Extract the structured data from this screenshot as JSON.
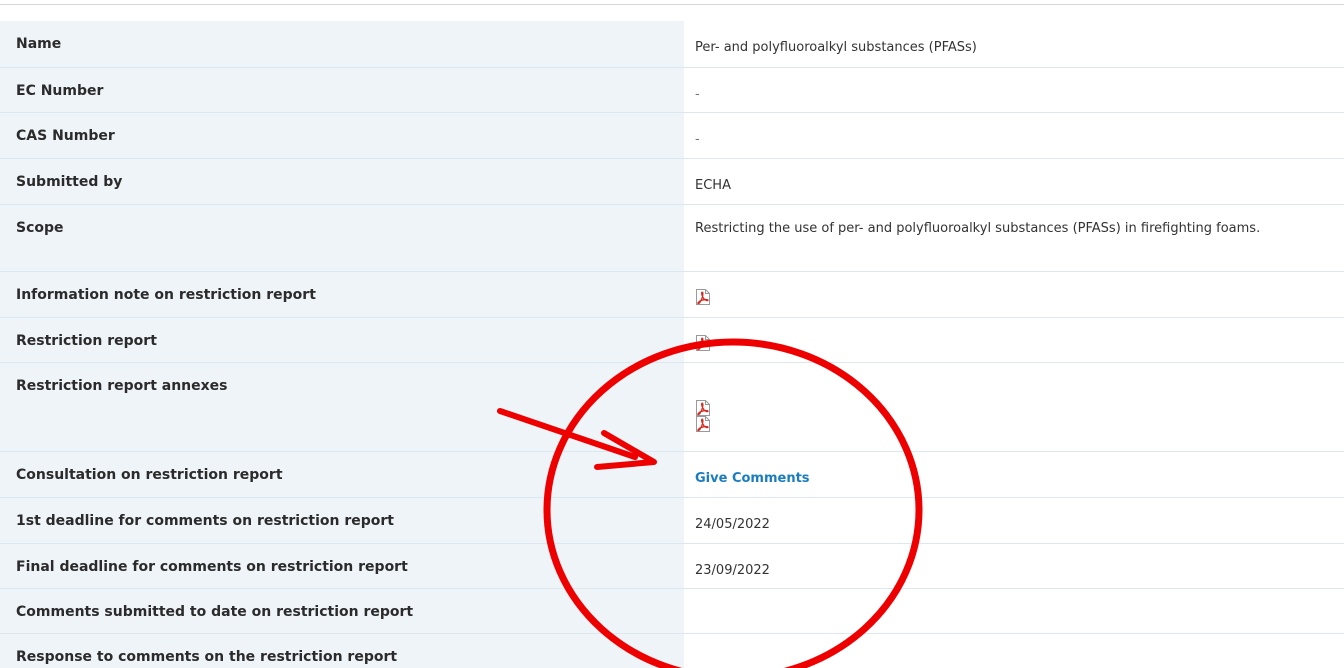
{
  "rows": [
    {
      "label": "Name",
      "value": "Per- and polyfluoroalkyl substances (PFASs)"
    },
    {
      "label": "EC Number",
      "value": "-"
    },
    {
      "label": "CAS Number",
      "value": "-"
    },
    {
      "label": "Submitted by",
      "value": "ECHA"
    },
    {
      "label": "Scope",
      "value": "Restricting the use of per- and polyfluoroalkyl substances (PFASs) in firefighting foams."
    },
    {
      "label": "Information note on restriction report",
      "icon": "pdf-icon"
    },
    {
      "label": "Restriction report",
      "icon": "pdf-icon"
    },
    {
      "label": "Restriction report annexes",
      "icons": [
        "pdf-icon",
        "pdf-icon"
      ]
    },
    {
      "label": "Consultation on restriction report",
      "link": "Give Comments"
    },
    {
      "label": "1st deadline for comments on restriction report",
      "value": "24/05/2022"
    },
    {
      "label": "Final deadline for comments on restriction report",
      "value": "23/09/2022"
    },
    {
      "label": "Comments submitted to date on restriction report",
      "value": ""
    },
    {
      "label": "Response to comments on the restriction report",
      "value": ""
    }
  ],
  "colors": {
    "label_bg": "#eff4f8",
    "link": "#1a7dc0",
    "pdf_red": "#d42a1f",
    "annotation_red": "#ee0000"
  },
  "annotation": {
    "shapes": [
      "red-circle-outline",
      "red-arrow"
    ]
  }
}
